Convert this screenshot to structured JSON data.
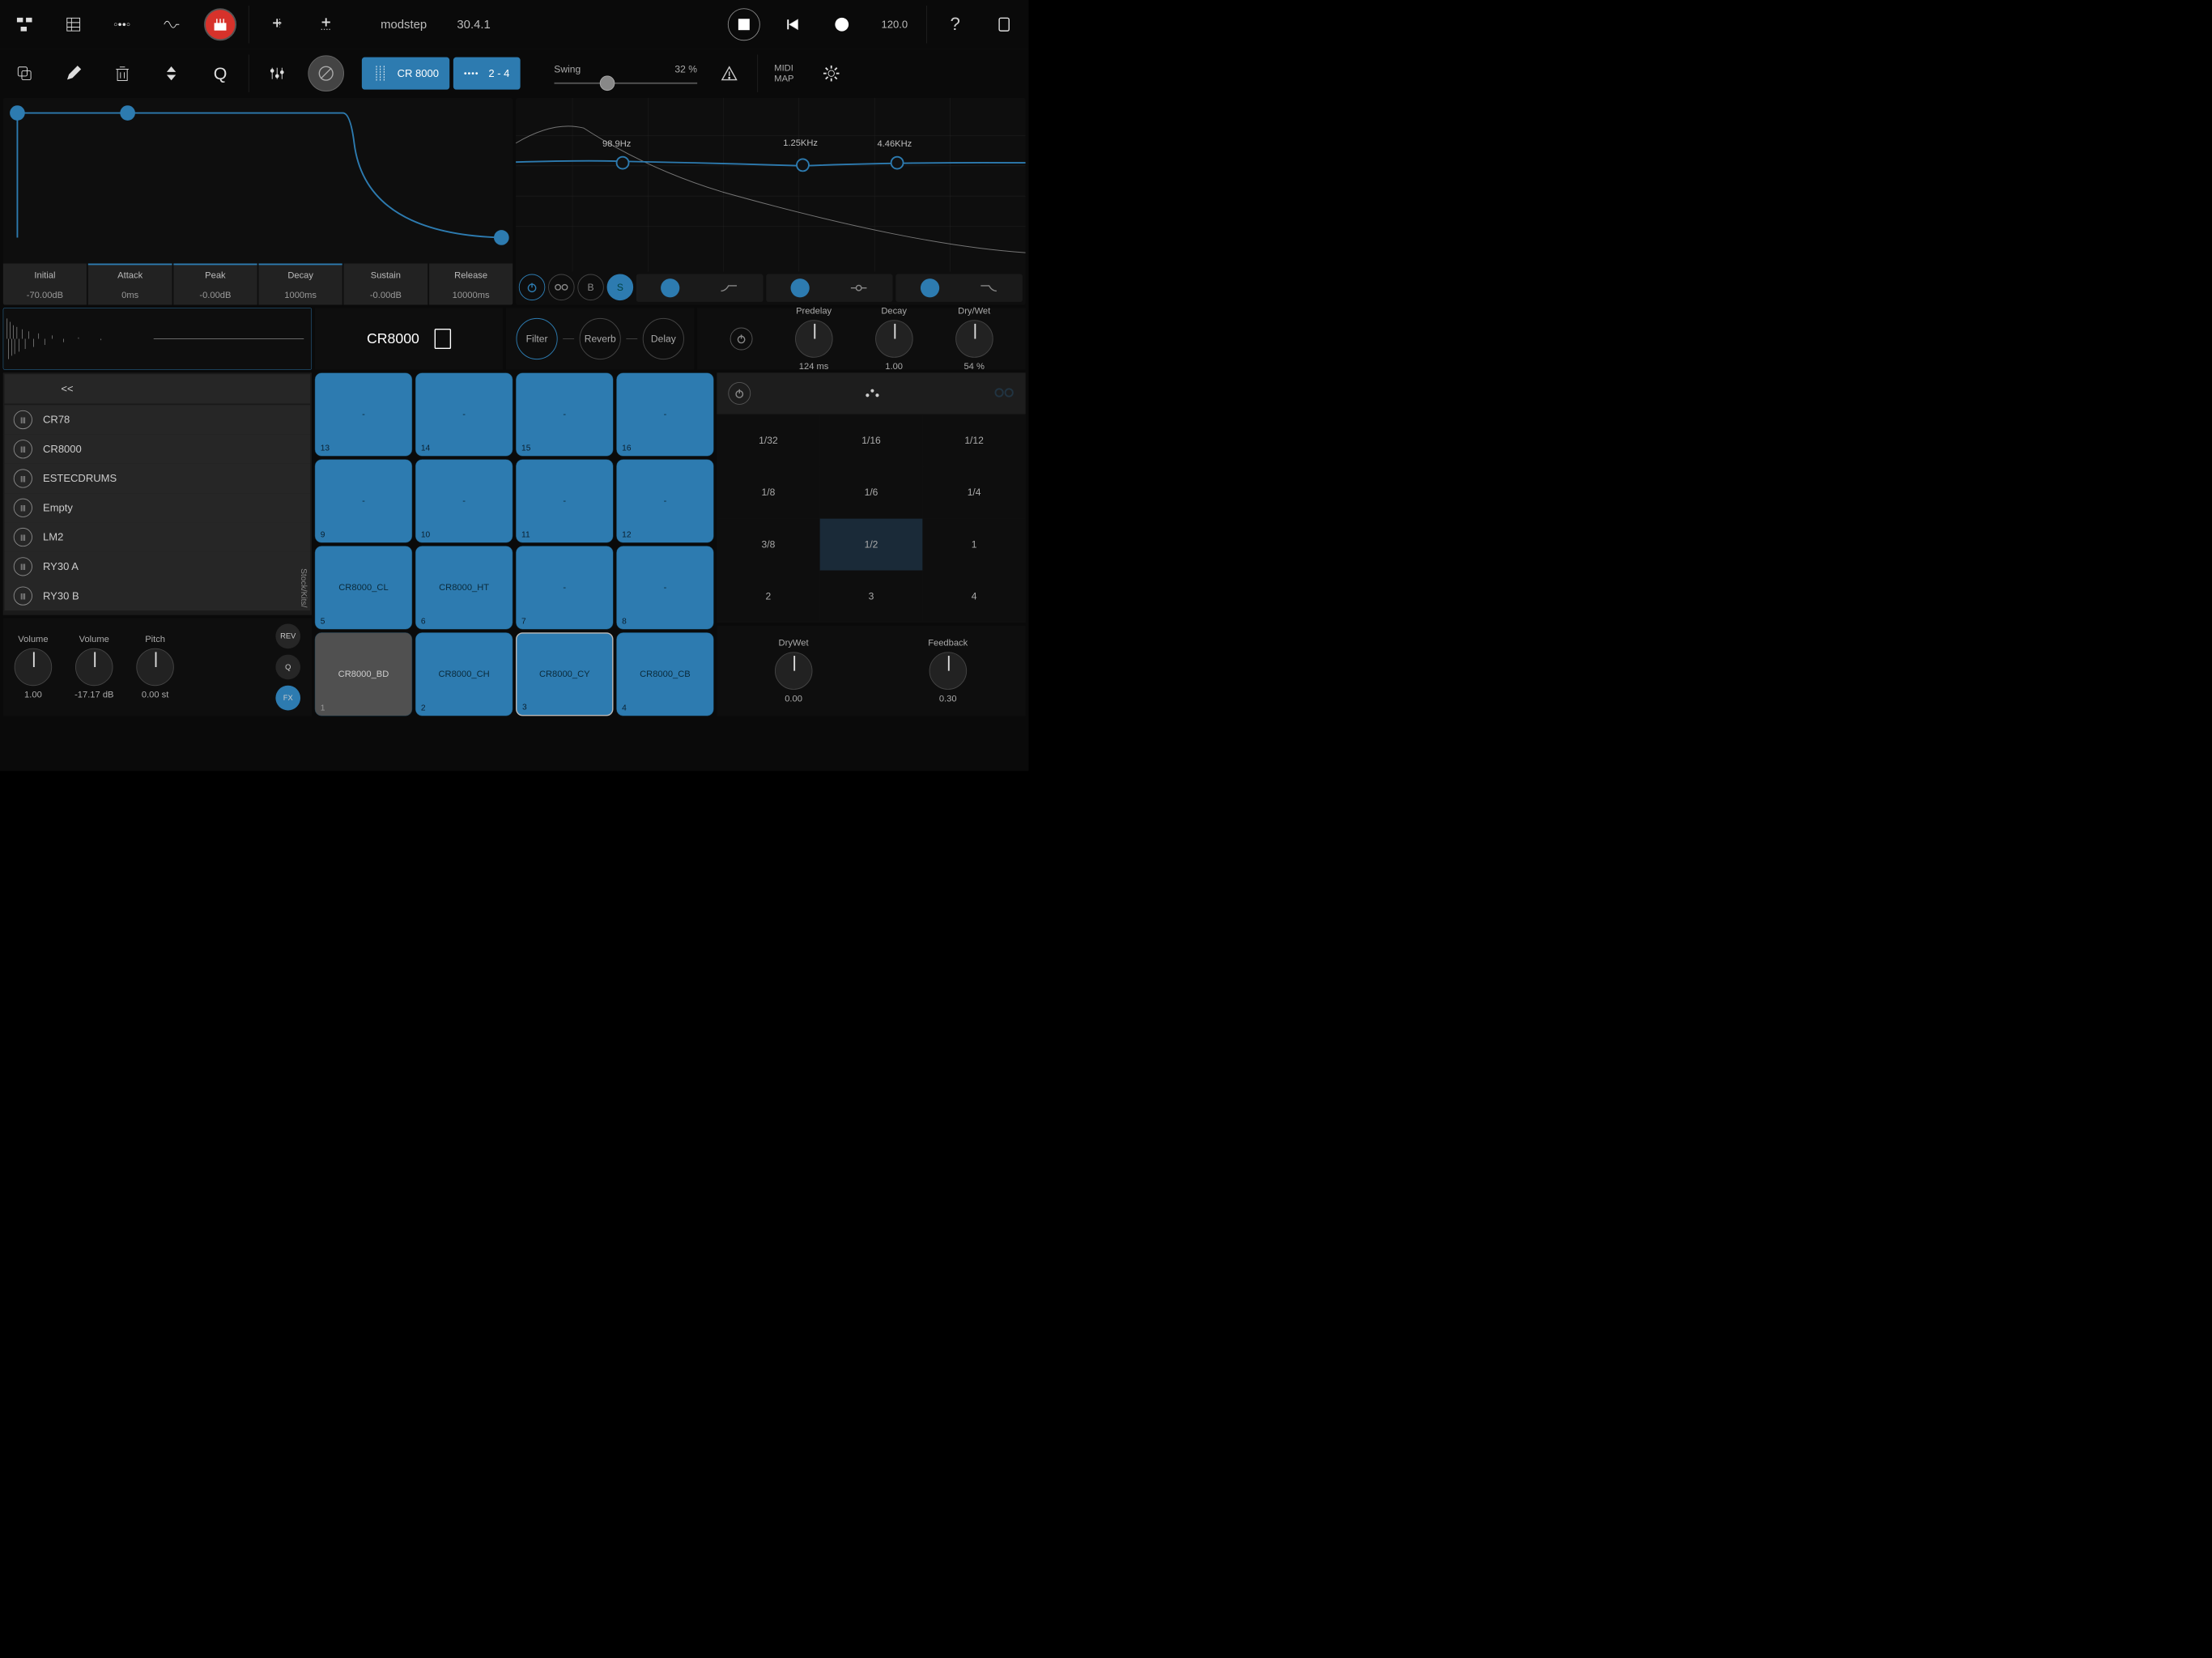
{
  "header": {
    "app": "modstep",
    "version": "30.4.1",
    "bpm": "120.0",
    "swing_label": "Swing",
    "swing_value": "32 %",
    "midi_map": "MIDI\nMAP",
    "track_pill": "CR 8000",
    "range_pill": "2 - 4"
  },
  "envelope": {
    "params": [
      {
        "label": "Initial",
        "value": "-70.00dB",
        "hl": false
      },
      {
        "label": "Attack",
        "value": "0ms",
        "hl": true
      },
      {
        "label": "Peak",
        "value": "-0.00dB",
        "hl": true
      },
      {
        "label": "Decay",
        "value": "1000ms",
        "hl": true
      },
      {
        "label": "Sustain",
        "value": "-0.00dB",
        "hl": false
      },
      {
        "label": "Release",
        "value": "10000ms",
        "hl": false
      }
    ]
  },
  "eq": {
    "freqs": [
      "98.9Hz",
      "1.25KHz",
      "4.46KHz"
    ],
    "btn_b": "B",
    "btn_s": "S"
  },
  "sample_name": "CR8000",
  "fx_chain": [
    "Filter",
    "Reverb",
    "Delay"
  ],
  "reverb": {
    "predelay_label": "Predelay",
    "predelay_val": "124 ms",
    "decay_label": "Decay",
    "decay_val": "1.00",
    "drywet_label": "Dry/Wet",
    "drywet_val": "54 %"
  },
  "kits": {
    "back": "<<",
    "path": "Stock/Kits/",
    "items": [
      "CR78",
      "CR8000",
      "ESTECDRUMS",
      "Empty",
      "LM2",
      "RY30 A",
      "RY30 B"
    ]
  },
  "volume_panel": {
    "knobs": [
      {
        "label": "Volume",
        "value": "1.00"
      },
      {
        "label": "Volume",
        "value": "-17.17 dB"
      },
      {
        "label": "Pitch",
        "value": "0.00 st"
      }
    ],
    "rev": "REV",
    "q": "Q",
    "fx": "FX"
  },
  "pads": [
    {
      "n": "13",
      "label": "-"
    },
    {
      "n": "14",
      "label": "-"
    },
    {
      "n": "15",
      "label": "-"
    },
    {
      "n": "16",
      "label": "-"
    },
    {
      "n": "9",
      "label": "-"
    },
    {
      "n": "10",
      "label": "-"
    },
    {
      "n": "11",
      "label": "-"
    },
    {
      "n": "12",
      "label": "-"
    },
    {
      "n": "5",
      "label": "CR8000_CL"
    },
    {
      "n": "6",
      "label": "CR8000_HT"
    },
    {
      "n": "7",
      "label": "-"
    },
    {
      "n": "8",
      "label": "-"
    },
    {
      "n": "1",
      "label": "CR8000_BD",
      "gray": true
    },
    {
      "n": "2",
      "label": "CR8000_CH"
    },
    {
      "n": "3",
      "label": "CR8000_CY",
      "selected": true
    },
    {
      "n": "4",
      "label": "CR8000_CB"
    }
  ],
  "divisions": [
    "1/32",
    "1/16",
    "1/12",
    "1/8",
    "1/6",
    "1/4",
    "3/8",
    "1/2",
    "1",
    "2",
    "3",
    "4"
  ],
  "division_selected": "1/2",
  "delay": {
    "drywet_label": "DryWet",
    "drywet_val": "0.00",
    "feedback_label": "Feedback",
    "feedback_val": "0.30"
  }
}
